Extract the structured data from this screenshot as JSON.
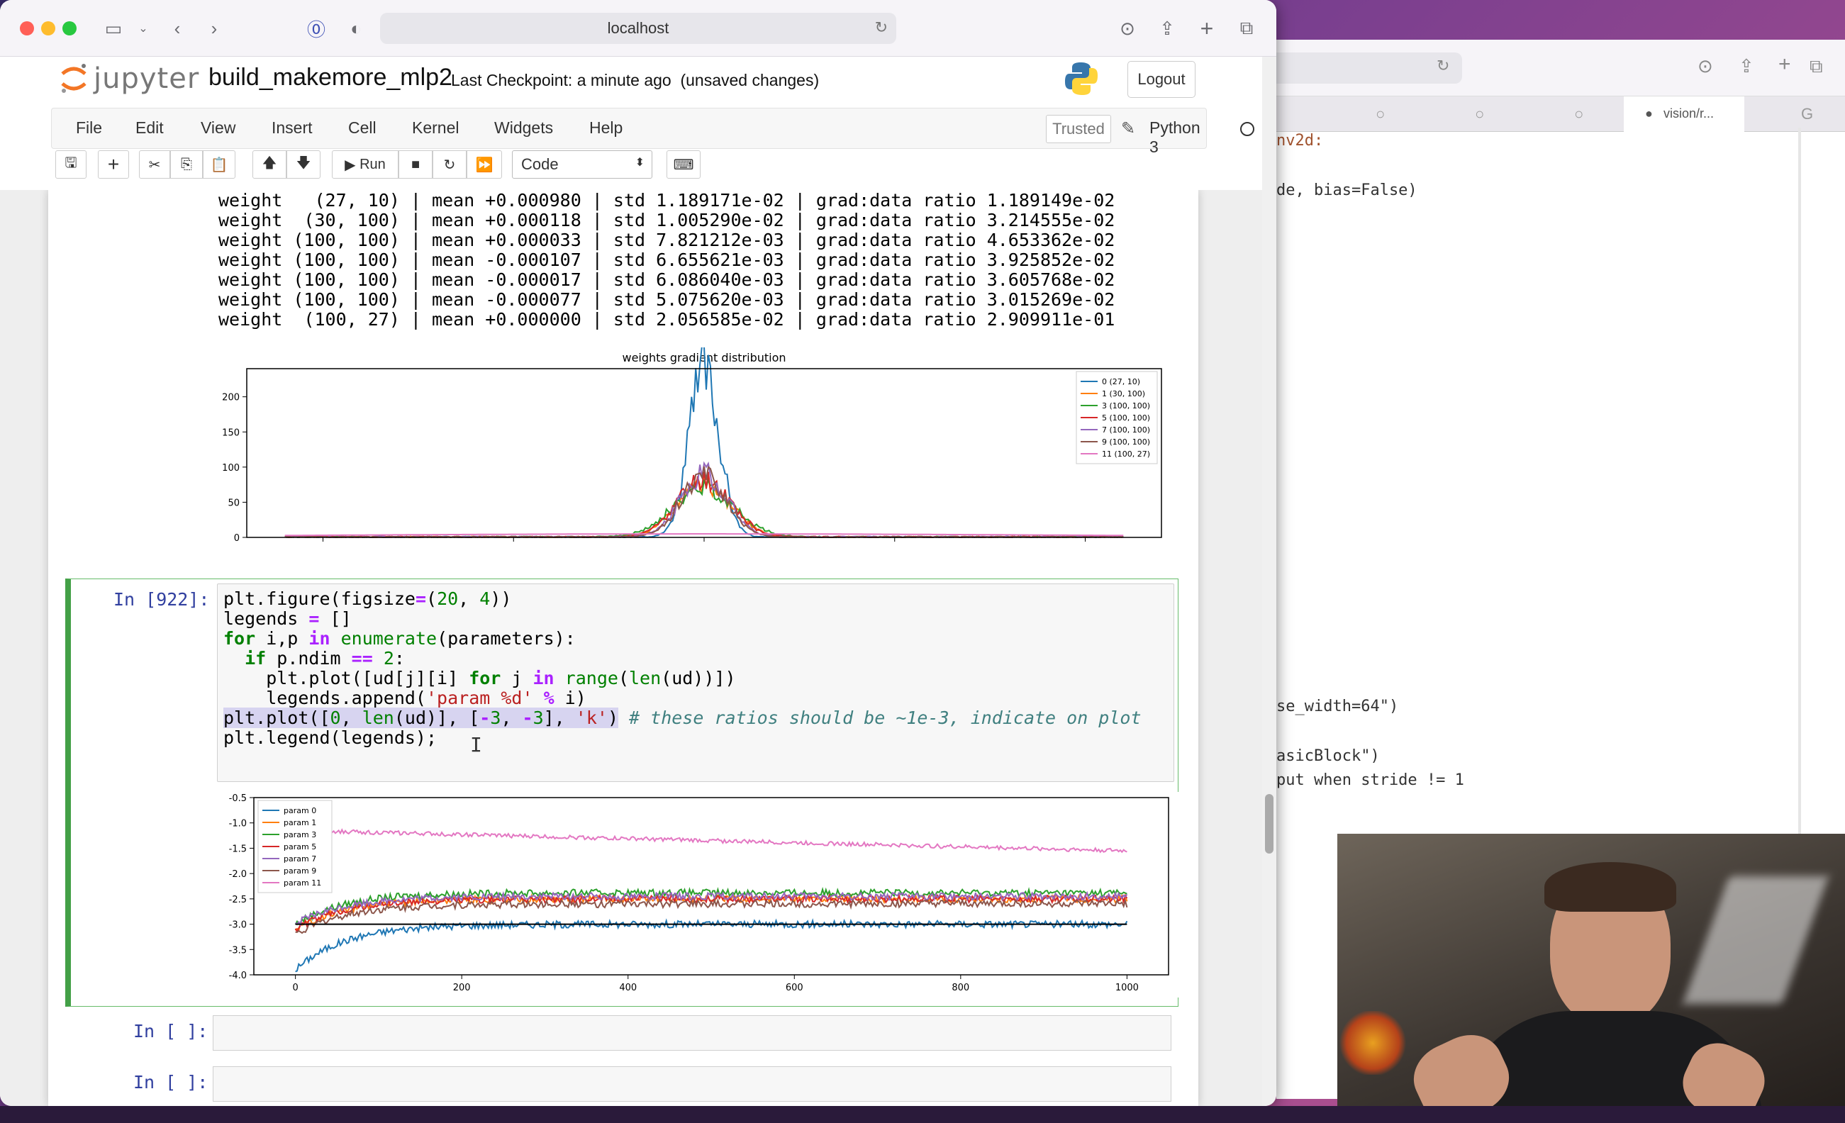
{
  "browser": {
    "url": "localhost",
    "icons": [
      "sidebar-icon",
      "chevron-down-icon",
      "back-icon",
      "forward-icon",
      "privacy-icon",
      "shield-icon",
      "reload-icon",
      "download-icon",
      "share-icon",
      "new-tab-icon",
      "tabs-overview-icon"
    ]
  },
  "jupyter": {
    "logo_text": "jupyter",
    "notebook_name": "build_makemore_mlp2",
    "checkpoint": "Last Checkpoint: a minute ago",
    "unsaved": "(unsaved changes)",
    "logout_label": "Logout",
    "menu": [
      "File",
      "Edit",
      "View",
      "Insert",
      "Cell",
      "Kernel",
      "Widgets",
      "Help"
    ],
    "trusted_label": "Trusted",
    "kernel_name": "Python 3",
    "run_label": "Run",
    "cell_type": "Code",
    "colors": {
      "accent": "#43a047",
      "prompt": "#303f9f",
      "keyword": "#008000",
      "comment": "#408080",
      "string": "#ba2121"
    }
  },
  "output_lines": [
    "weight   (27, 10) | mean +0.000980 | std 1.189171e-02 | grad:data ratio 1.189149e-02",
    "weight  (30, 100) | mean +0.000118 | std 1.005290e-02 | grad:data ratio 3.214555e-02",
    "weight (100, 100) | mean +0.000033 | std 7.821212e-03 | grad:data ratio 4.653362e-02",
    "weight (100, 100) | mean -0.000107 | std 6.655621e-03 | grad:data ratio 3.925852e-02",
    "weight (100, 100) | mean -0.000017 | std 6.086040e-03 | grad:data ratio 3.605768e-02",
    "weight (100, 100) | mean -0.000077 | std 5.075620e-03 | grad:data ratio 3.015269e-02",
    "weight  (100, 27) | mean +0.000000 | std 2.056585e-02 | grad:data ratio 2.909911e-01"
  ],
  "cell": {
    "prompt": "In [922]:",
    "code_parts": {
      "l1a": "plt.figure(figsize",
      "l1b": "=",
      "l1c": "(",
      "l1d": "20",
      "l1e": ", ",
      "l1f": "4",
      "l1g": "))",
      "l2a": "legends ",
      "l2b": "=",
      "l2c": " []",
      "l3a": "for",
      "l3b": " i,p ",
      "l3c": "in",
      "l3d": " ",
      "l3e": "enumerate",
      "l3f": "(parameters):",
      "l4a": "  ",
      "l4b": "if",
      "l4c": " p.ndim ",
      "l4d": "==",
      "l4e": " ",
      "l4f": "2",
      "l4g": ":",
      "l5a": "    plt.plot([ud[j][i] ",
      "l5b": "for",
      "l5c": " j ",
      "l5d": "in",
      "l5e": " ",
      "l5f": "range",
      "l5g": "(",
      "l5h": "len",
      "l5i": "(ud))])",
      "l6a": "    legends.append(",
      "l6b": "'param %d'",
      "l6c": " ",
      "l6d": "%",
      "l6e": " i)",
      "l7a": "plt.plot([",
      "l7b": "0",
      "l7c": ", ",
      "l7d": "len",
      "l7e": "(ud)], [",
      "l7f": "-",
      "l7g": "3",
      "l7h": ", ",
      "l7i": "-",
      "l7j": "3",
      "l7k": "], ",
      "l7l": "'k'",
      "l7m": ")",
      "l7n": " # these ratios should be ~1e-3, indicate on plot",
      "l8a": "plt.legend(legends);"
    }
  },
  "empty_prompts": [
    "In [ ]:",
    "In [ ]:"
  ],
  "chart_data": [
    {
      "type": "line",
      "title": "weights gradient distribution",
      "xlim": [
        -0.12,
        0.12
      ],
      "ylim": [
        0,
        240
      ],
      "xticks": [
        "-0.10",
        "-0.05",
        "0.00",
        "0.05",
        "0.10"
      ],
      "yticks": [
        "0",
        "50",
        "100",
        "150",
        "200"
      ],
      "grid": false,
      "legend_placement": "top-right",
      "series": [
        {
          "name": "0 (27, 10)",
          "color": "#1f77b4",
          "peak": 235,
          "width": 0.004
        },
        {
          "name": "1 (30, 100)",
          "color": "#ff7f0e",
          "peak": 75,
          "width": 0.007
        },
        {
          "name": "3 (100, 100)",
          "color": "#2ca02c",
          "peak": 70,
          "width": 0.008
        },
        {
          "name": "5 (100, 100)",
          "color": "#d62728",
          "peak": 80,
          "width": 0.007
        },
        {
          "name": "7 (100, 100)",
          "color": "#9467bd",
          "peak": 90,
          "width": 0.006
        },
        {
          "name": "9 (100, 100)",
          "color": "#8c564b",
          "peak": 85,
          "width": 0.006
        },
        {
          "name": "11 (100, 27)",
          "color": "#e377c2",
          "peak": 5,
          "width": 0.1
        }
      ]
    },
    {
      "type": "line",
      "xlim": [
        -50,
        1050
      ],
      "ylim": [
        -4.0,
        -0.5
      ],
      "xticks": [
        "0",
        "200",
        "400",
        "600",
        "800",
        "1000"
      ],
      "yticks": [
        "-0.5",
        "-1.0",
        "-1.5",
        "-2.0",
        "-2.5",
        "-3.0",
        "-3.5",
        "-4.0"
      ],
      "grid": false,
      "legend_placement": "top-left",
      "series": [
        {
          "name": "param 0",
          "color": "#1f77b4",
          "start": -3.9,
          "end": -3.0
        },
        {
          "name": "param 1",
          "color": "#ff7f0e",
          "start": -3.1,
          "end": -2.5
        },
        {
          "name": "param 3",
          "color": "#2ca02c",
          "start": -3.0,
          "end": -2.38
        },
        {
          "name": "param 5",
          "color": "#d62728",
          "start": -3.1,
          "end": -2.5
        },
        {
          "name": "param 7",
          "color": "#9467bd",
          "start": -3.0,
          "end": -2.45
        },
        {
          "name": "param 9",
          "color": "#8c564b",
          "start": -3.2,
          "end": -2.6
        },
        {
          "name": "param 11",
          "color": "#e377c2",
          "start": -1.15,
          "end": -1.55
        }
      ]
    }
  ],
  "bg_window": {
    "tab_label": "vision/r...",
    "code_lines": [
      "nv2d:",
      "de, bias=False)",
      "se_width=64\")",
      "asicBlock\")",
      "put when stride != 1"
    ]
  }
}
